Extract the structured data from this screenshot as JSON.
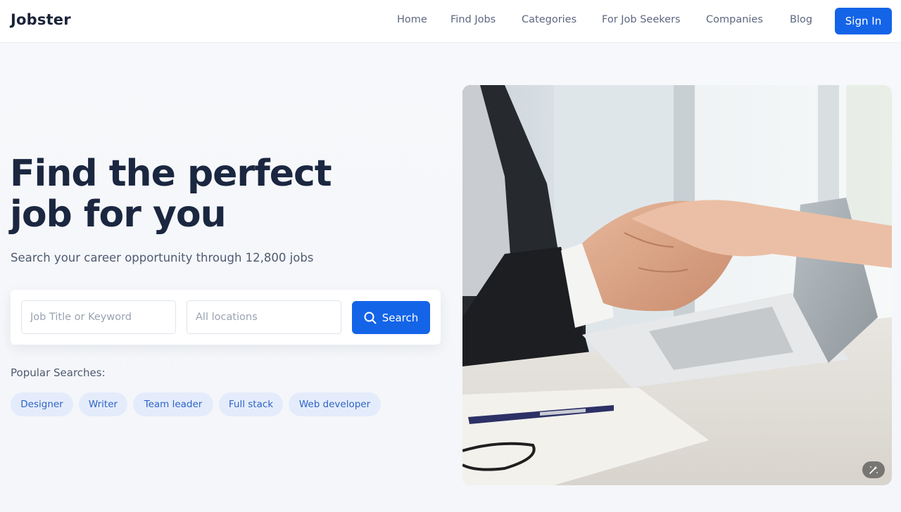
{
  "nav": {
    "logo": "Jobster",
    "links": [
      "Home",
      "Find Jobs",
      "Categories",
      "For Job Seekers",
      "Companies",
      "Blog"
    ],
    "signin": "Sign In"
  },
  "hero": {
    "title_line1": "Find the perfect",
    "title_line2": "job for you",
    "subtitle": "Search your career opportunity through 12,800 jobs"
  },
  "search": {
    "keyword_placeholder": "Job Title or Keyword",
    "location_placeholder": "All locations",
    "button_label": "Search"
  },
  "popular": {
    "label": "Popular Searches:",
    "tags": [
      "Designer",
      "Writer",
      "Team leader",
      "Full stack",
      "Web developer"
    ]
  },
  "colors": {
    "accent": "#1464e8",
    "tag_bg": "#e4ecfb",
    "tag_text": "#2f63c6",
    "heading": "#1b2740"
  },
  "icons": {
    "search": "search-icon",
    "zoom": "magic-wand-icon"
  }
}
